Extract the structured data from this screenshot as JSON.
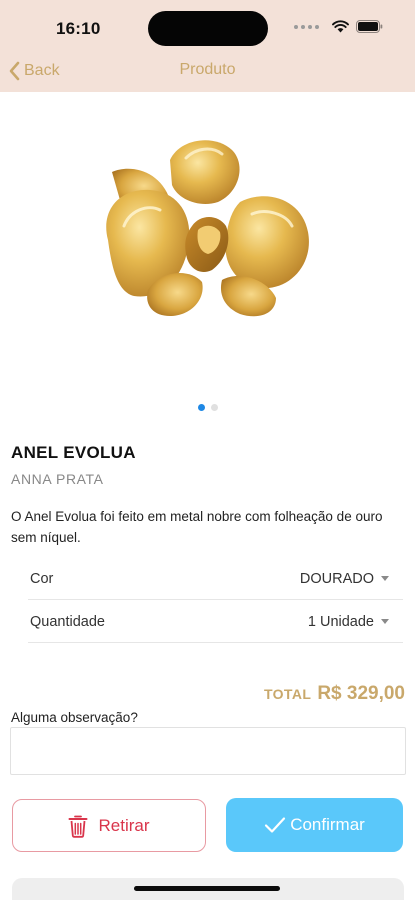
{
  "status_bar": {
    "time": "16:10"
  },
  "nav": {
    "back_label": "Back",
    "title": "Produto"
  },
  "gallery": {
    "page_count": 2,
    "active_page": 0,
    "active_color": "#1e88e5",
    "inactive_color": "#e0e0e0"
  },
  "product": {
    "name": "ANEL EVOLUA",
    "brand": "ANNA PRATA",
    "description": "O Anel Evolua foi feito em metal nobre com folheação de ouro sem níquel."
  },
  "options": [
    {
      "label": "Cor",
      "value": "DOURADO"
    },
    {
      "label": "Quantidade",
      "value": "1 Unidade"
    }
  ],
  "total": {
    "label": "TOTAL",
    "value": "R$ 329,00"
  },
  "observation": {
    "label": "Alguma observação?",
    "value": "",
    "placeholder": ""
  },
  "actions": {
    "remove_label": "Retirar",
    "confirm_label": "Confirmar"
  },
  "colors": {
    "accent_gold": "#c9a86b",
    "header_bg": "#f3e1d8",
    "confirm_blue": "#5ac8fa",
    "remove_red": "#d9354b"
  },
  "icons": {
    "back": "chevron-left-icon",
    "remove": "trash-icon",
    "confirm": "checkmark-icon"
  }
}
